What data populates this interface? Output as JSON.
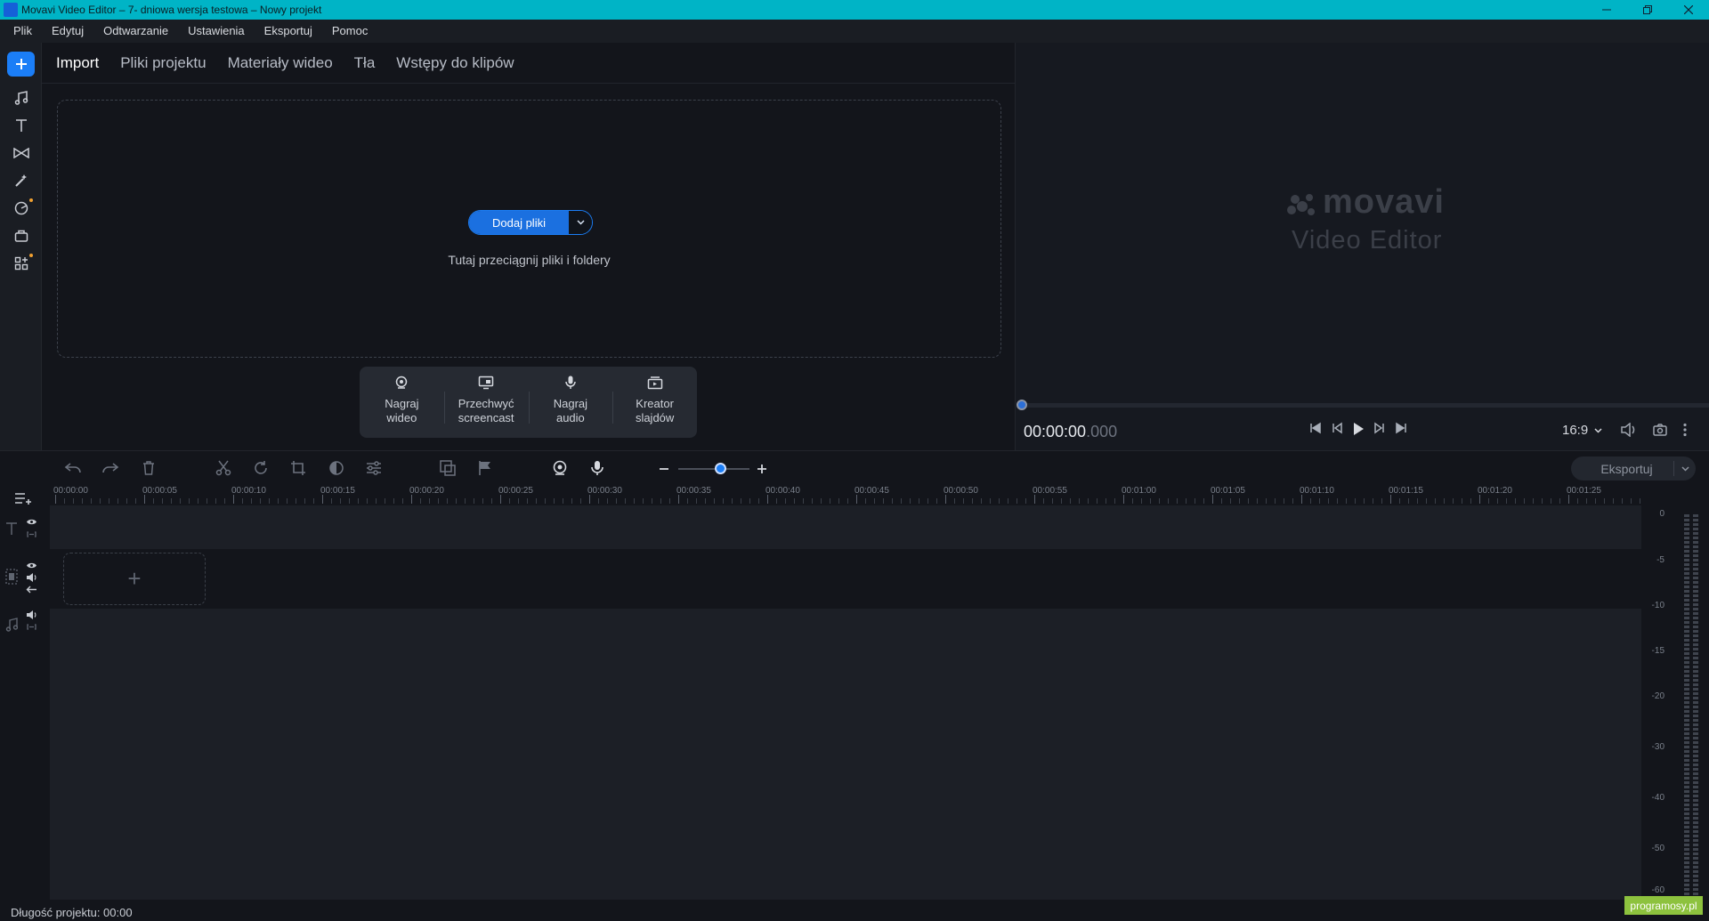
{
  "window": {
    "title": "Movavi Video Editor – 7- dniowa wersja testowa – Nowy projekt"
  },
  "menu": [
    "Plik",
    "Edytuj",
    "Odtwarzanie",
    "Ustawienia",
    "Eksportuj",
    "Pomoc"
  ],
  "rail": {
    "items": [
      "add-icon",
      "music-icon",
      "text-icon",
      "transitions-icon",
      "effects-icon",
      "stickers-icon",
      "tools-icon",
      "more-icon"
    ]
  },
  "tabs": [
    "Import",
    "Pliki projektu",
    "Materiały wideo",
    "Tła",
    "Wstępy do klipów"
  ],
  "import": {
    "add_files_label": "Dodaj pliki",
    "drop_hint": "Tutaj przeciągnij pliki i foldery",
    "record_buttons": [
      {
        "icon": "webcam-icon",
        "line1": "Nagraj",
        "line2": "wideo"
      },
      {
        "icon": "screencast-icon",
        "line1": "Przechwyć",
        "line2": "screencast"
      },
      {
        "icon": "microphone-icon",
        "line1": "Nagraj",
        "line2": "audio"
      },
      {
        "icon": "slideshow-icon",
        "line1": "Kreator",
        "line2": "slajdów"
      }
    ]
  },
  "preview": {
    "logo_brand": "movavi",
    "logo_sub": "Video Editor",
    "timecode_main": "00:00:00",
    "timecode_ms": ".000",
    "aspect_ratio": "16:9"
  },
  "timeline": {
    "export_label": "Eksportuj",
    "ruler_labels": [
      "00:00:00",
      "00:00:05",
      "00:00:10",
      "00:00:15",
      "00:00:20",
      "00:00:25",
      "00:00:30",
      "00:00:35",
      "00:00:40",
      "00:00:45",
      "00:00:50",
      "00:00:55",
      "00:01:00",
      "00:01:05",
      "00:01:10",
      "00:01:15",
      "00:01:20",
      "00:01:25"
    ],
    "add_clip_symbol": "+"
  },
  "meter": {
    "db_labels": [
      "0",
      "-5",
      "-10",
      "-15",
      "-20",
      "-30",
      "-40",
      "-50",
      "-60"
    ]
  },
  "status": {
    "project_length": "Długość projektu: 00:00"
  },
  "watermark": "programosy.pl",
  "colors": {
    "accent": "#1b7ef7",
    "titlebar": "#00b4c6",
    "background": "#13151b"
  }
}
